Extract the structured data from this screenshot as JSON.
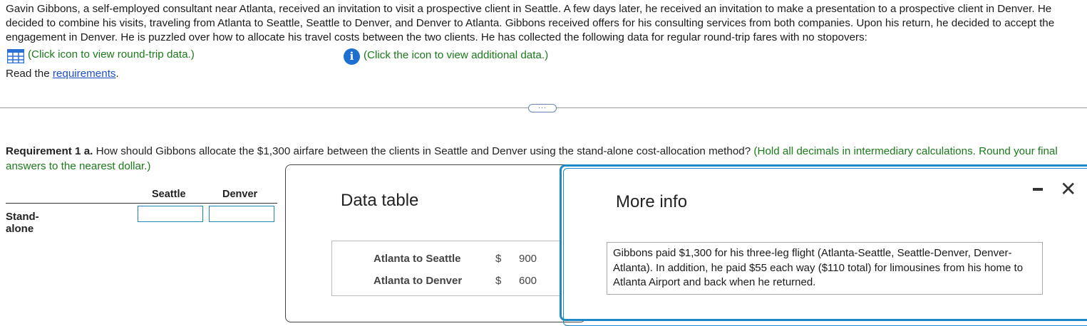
{
  "problem": {
    "text": "Gavin Gibbons, a self-employed consultant near Atlanta, received an invitation to visit a prospective client in Seattle. A few days later, he received an invitation to make a presentation to a prospective client in Denver. He decided to combine his visits, traveling from Atlanta to Seattle, Seattle to Denver, and Denver to Atlanta. Gibbons received offers for his consulting services from both companies. Upon his return, he decided to accept the engagement in Denver. He is puzzled over how to allocate his travel costs between the two clients. He has collected the following data for regular round-trip fares with no stopovers:"
  },
  "links": {
    "roundtrip_label": "(Click icon to view round-trip data.)",
    "additional_label": "(Click the icon to view additional data.)",
    "read_prefix": "Read the ",
    "requirements_link": "requirements",
    "read_suffix": "."
  },
  "requirement": {
    "bold": "Requirement 1 a.",
    "question": " How should Gibbons allocate the $1,300 airfare between the clients in Seattle and Denver using the stand-alone cost-allocation method? ",
    "hint": "(Hold all decimals in intermediary calculations. Round your final answers to the nearest dollar.)"
  },
  "answer_table": {
    "columns": [
      "Seattle",
      "Denver"
    ],
    "row_label": "Stand-alone",
    "values": [
      "",
      ""
    ]
  },
  "data_table_modal": {
    "title": "Data table",
    "rows": [
      {
        "route": "Atlanta to Seattle",
        "currency": "$",
        "fare": "900"
      },
      {
        "route": "Atlanta to Denver",
        "currency": "$",
        "fare": "600"
      }
    ]
  },
  "more_info_modal": {
    "title": "More info",
    "text": "Gibbons paid $1,300 for his three-leg flight (Atlanta-Seattle, Seattle-Denver, Denver-Atlanta). In addition, he paid $55 each way ($110 total) for limousines from his home to Atlanta Airport and back when he returned."
  },
  "icons": {
    "table": "table-grid-icon",
    "info": "info-icon",
    "more": "ellipsis-icon",
    "minimize": "minimize-icon",
    "close": "close-icon"
  },
  "colors": {
    "link_green": "#1a7a1a",
    "link_blue": "#1e4fd2",
    "modal_border": "#1e88c8"
  }
}
